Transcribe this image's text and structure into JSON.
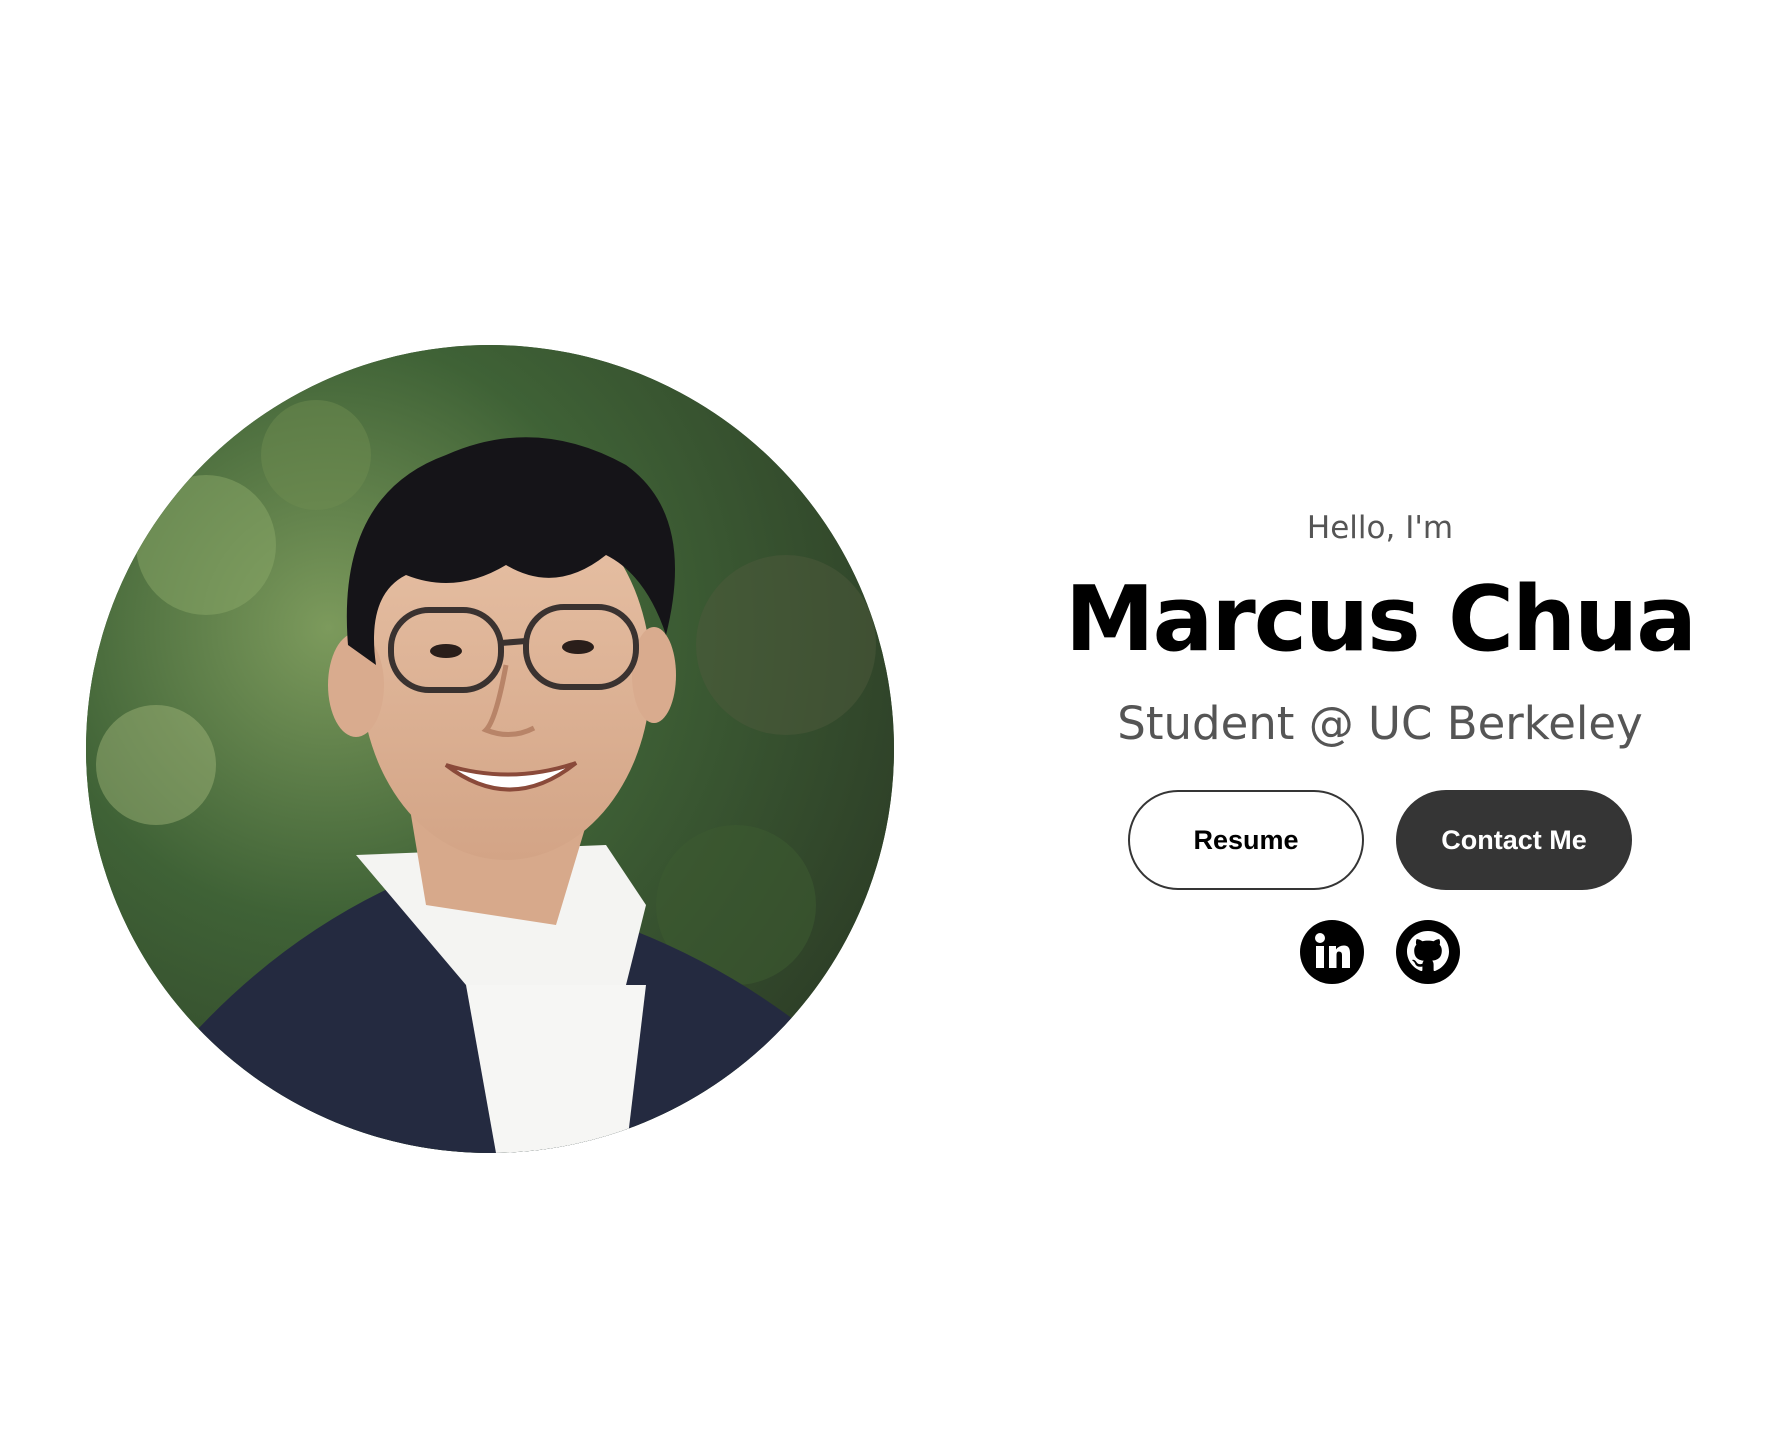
{
  "hero": {
    "greeting": "Hello, I'm",
    "name": "Marcus Chua",
    "subtitle": "Student @ UC Berkeley",
    "photo_alt": "Profile picture of Marcus Chua"
  },
  "buttons": {
    "resume_label": "Resume",
    "contact_label": "Contact Me"
  },
  "socials": [
    {
      "icon": "linkedin-icon",
      "label": "LinkedIn"
    },
    {
      "icon": "github-icon",
      "label": "GitHub"
    }
  ],
  "colors": {
    "background": "#ffffff",
    "text_primary": "#000000",
    "text_secondary": "#555555",
    "button_dark": "#353535"
  }
}
